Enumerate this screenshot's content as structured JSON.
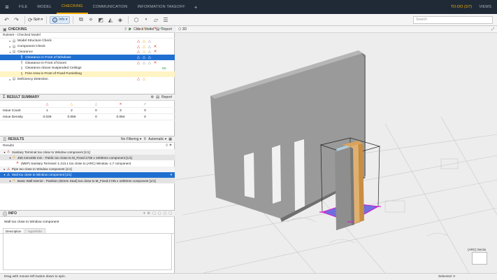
{
  "menu": {
    "items": [
      "FILE",
      "MODEL",
      "CHECKING",
      "COMMUNICATION",
      "INFORMATION TAKEOFF"
    ],
    "active": "CHECKING",
    "todo": "TO-DO (2/7)",
    "views": "VIEWS"
  },
  "toolbar": {
    "spin_label": "Spin",
    "info_label": "Info",
    "search_placeholder": "Search"
  },
  "checking": {
    "title": "CHECKING",
    "check_model": "Check Model",
    "report": "Report",
    "ruleset": "Ruleset - Checked Model",
    "rows": [
      {
        "label": "Model Structure Check",
        "indent": 1
      },
      {
        "label": "Component Check",
        "indent": 1
      },
      {
        "label": "Clearance",
        "indent": 1
      },
      {
        "label": "Clearance in Front of Windows",
        "indent": 3
      },
      {
        "label": "Clearance in Front of Doors",
        "indent": 3
      },
      {
        "label": "Clearance Above Suspended Ceilings",
        "indent": 3
      },
      {
        "label": "Free Area in Front of Fixed Furnishing",
        "indent": 3
      },
      {
        "label": "Deficiency Detection",
        "indent": 1
      }
    ],
    "ok_count": "OK"
  },
  "summary": {
    "title": "RESULT SUMMARY",
    "report": "Report",
    "rows": [
      {
        "label": "Issue Count",
        "values": [
          "1",
          "2",
          "0",
          "3",
          "0"
        ]
      },
      {
        "label": "Issue Density",
        "values": [
          "0.028",
          "0.056",
          "0",
          "0.084",
          "0"
        ]
      }
    ]
  },
  "results": {
    "title": "RESULTS",
    "filter": "No Filtering",
    "auto": "Automatic",
    "sub": "Results",
    "rows": [
      {
        "label": "Sanitary Terminal too close to Window component [1/1]",
        "kind": "group"
      },
      {
        "label": "455 mmx455 mm - Public too close to M_Fixed:1735 x 1000mm component [1/1]",
        "kind": "subsel"
      },
      {
        "label": "(MEP) Sanitary Terminal:-1.213.1 too close to (ARC) Window.-1.7 component",
        "kind": "item"
      },
      {
        "label": "Pipe too close to Window component [1/1]",
        "kind": "group"
      },
      {
        "label": "Wall too close to Window component [1/1]",
        "kind": "sel"
      },
      {
        "label": "Basic Wall:Interior - Partition (92mm Stud) too close to M_Fixed:1735 x 1000mm component [1/1]",
        "kind": "subsel"
      }
    ]
  },
  "info": {
    "title": "INFO",
    "text": "Wall too close to Window component",
    "tabs": [
      "Description",
      "Hyperlinks"
    ]
  },
  "view": {
    "title": "3D",
    "cube_label": "(ARC) Sectio"
  },
  "status": {
    "left": "Drag with mouse left button down to spin.",
    "right": "Selected: 0"
  }
}
